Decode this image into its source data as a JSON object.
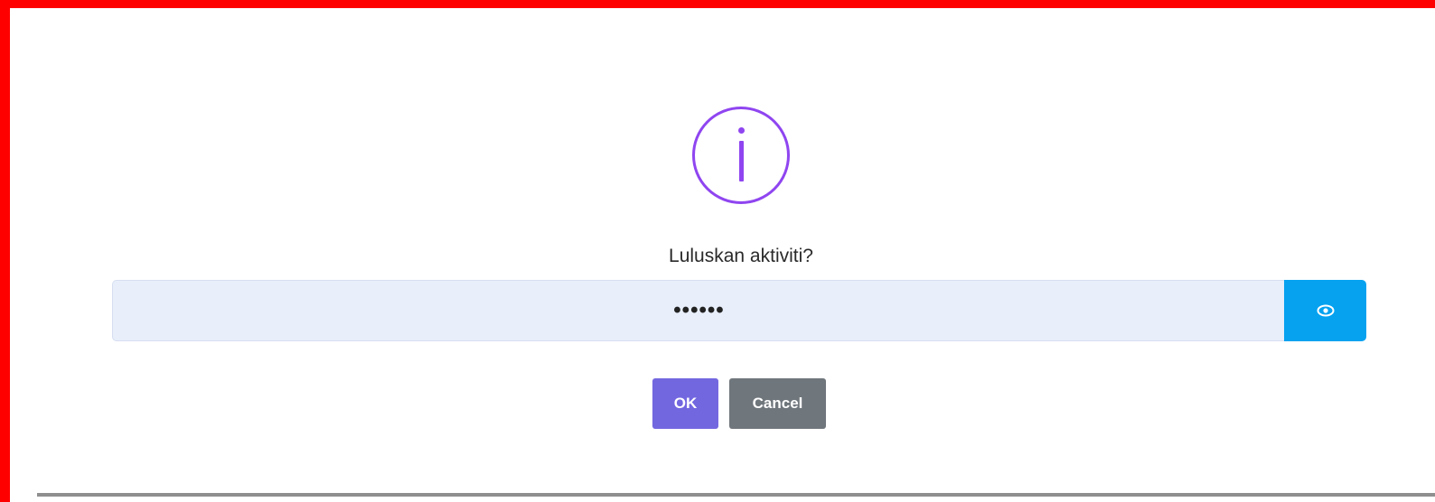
{
  "dialog": {
    "title": "Luluskan aktiviti?",
    "icon": "info-icon",
    "password": {
      "value": "••••••",
      "toggle_icon": "eye-icon"
    },
    "ok_label": "OK",
    "cancel_label": "Cancel"
  },
  "colors": {
    "frame_border": "#ff0000",
    "icon_accent": "#8f45f0",
    "input_bg": "#e8effb",
    "eye_button_bg": "#06a2f0",
    "ok_bg": "#7367e0",
    "cancel_bg": "#6f767c"
  }
}
